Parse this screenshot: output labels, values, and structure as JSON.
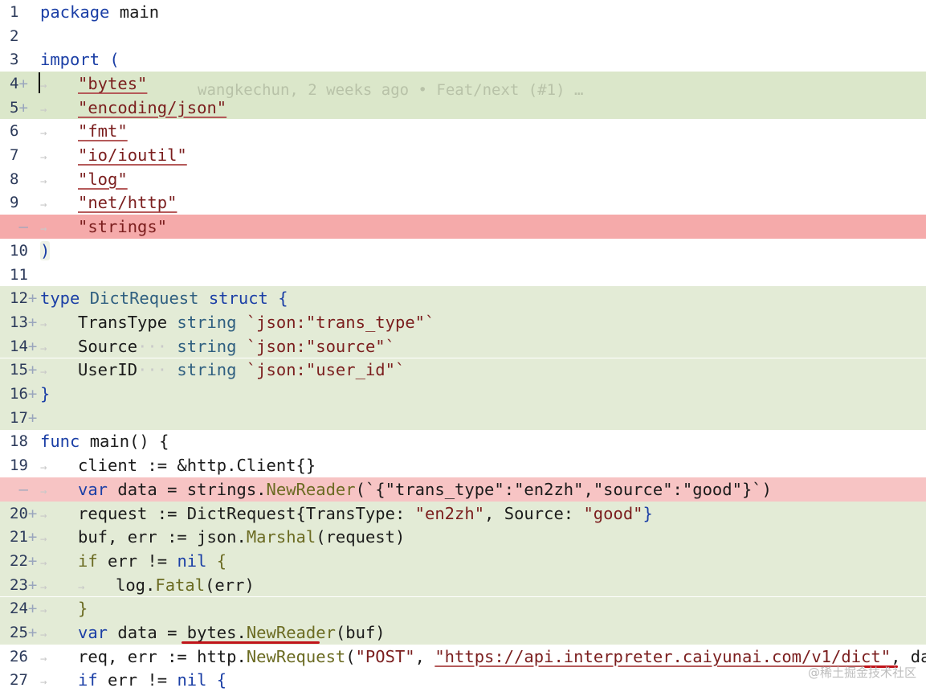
{
  "blame": "wangkechun, 2 weeks ago • Feat/next (#1) …",
  "watermark": "@稀土掘金技术社区",
  "lines": {
    "l1": {
      "num": "1",
      "mark": ""
    },
    "l2": {
      "num": "2",
      "mark": ""
    },
    "l3": {
      "num": "3",
      "mark": ""
    },
    "l4": {
      "num": "4",
      "mark": "+"
    },
    "l5": {
      "num": "5",
      "mark": "+"
    },
    "l6": {
      "num": "6",
      "mark": ""
    },
    "l7": {
      "num": "7",
      "mark": ""
    },
    "l8": {
      "num": "8",
      "mark": ""
    },
    "l9": {
      "num": "9",
      "mark": ""
    },
    "lr1": {
      "num": " ",
      "mark": "—"
    },
    "l10": {
      "num": "10",
      "mark": ""
    },
    "l11": {
      "num": "11",
      "mark": ""
    },
    "l12": {
      "num": "12",
      "mark": "+"
    },
    "l13": {
      "num": "13",
      "mark": "+"
    },
    "l14": {
      "num": "14",
      "mark": "+"
    },
    "l15": {
      "num": "15",
      "mark": "+"
    },
    "l16": {
      "num": "16",
      "mark": "+"
    },
    "l17": {
      "num": "17",
      "mark": "+"
    },
    "l18": {
      "num": "18",
      "mark": ""
    },
    "l19": {
      "num": "19",
      "mark": ""
    },
    "lr2": {
      "num": " ",
      "mark": "—"
    },
    "l20": {
      "num": "20",
      "mark": "+"
    },
    "l21": {
      "num": "21",
      "mark": "+"
    },
    "l22": {
      "num": "22",
      "mark": "+"
    },
    "l23": {
      "num": "23",
      "mark": "+"
    },
    "l24": {
      "num": "24",
      "mark": "+"
    },
    "l25": {
      "num": "25",
      "mark": "+"
    },
    "l26": {
      "num": "26",
      "mark": ""
    },
    "l27": {
      "num": "27",
      "mark": ""
    }
  },
  "code": {
    "package_kw": "package",
    "package_name": " main",
    "import_kw": "import",
    "import_paren": " (",
    "imp_bytes": "\"bytes\"",
    "imp_json": "\"encoding/json\"",
    "imp_fmt": "\"fmt\"",
    "imp_ioutil": "\"io/ioutil\"",
    "imp_log": "\"log\"",
    "imp_http": "\"net/http\"",
    "imp_strings": "\"strings\"",
    "close_paren": ")",
    "type_kw": "type",
    "type_name": " DictRequest ",
    "struct_kw": "struct",
    "open_brace": " {",
    "f1_name": "TransType",
    "f1_type": " string ",
    "f1_tag": "`json:\"trans_type\"`",
    "f2_name": "Source",
    "f2_dots": "···",
    "f2_type": " string ",
    "f2_tag": "`json:\"source\"`",
    "f3_name": "UserID",
    "f3_dots": "···",
    "f3_type": " string ",
    "f3_tag": "`json:\"user_id\"`",
    "close_brace": "}",
    "func_kw": "func",
    "func_sig": " main() {",
    "l19_code": "client := &http.Client{}",
    "r2_var": "var",
    "r2_a": " data = strings.",
    "r2_fn": "NewReader",
    "r2_b": "(`{\"trans_type\":\"en2zh\",\"source\":\"good\"}`)",
    "l20_a": "request := DictRequest{TransType: ",
    "l20_s1": "\"en2zh\"",
    "l20_b": ", Source: ",
    "l20_s2": "\"good\"",
    "l20_c": "}",
    "l21_a": "buf, err := json.",
    "l21_fn": "Marshal",
    "l21_b": "(request)",
    "l22_if": "if",
    "l22_a": " err != ",
    "l22_nil": "nil",
    "l22_b": " {",
    "l23_a": "log.",
    "l23_fn": "Fatal",
    "l23_b": "(err)",
    "l24": "}",
    "l25_var": "var",
    "l25_a": " data = bytes.",
    "l25_fn": "NewReader",
    "l25_b": "(buf)",
    "l26_a": "req, err := http.",
    "l26_fn": "NewRequest",
    "l26_b": "(",
    "l26_s1": "\"POST\"",
    "l26_c": ", ",
    "l26_s2": "\"https://api.interpreter.caiyunai.com/v1/dict\"",
    "l26_d": ", data)",
    "l27_if": "if",
    "l27_a": " err != ",
    "l27_nil": "nil",
    "l27_b": " {"
  }
}
